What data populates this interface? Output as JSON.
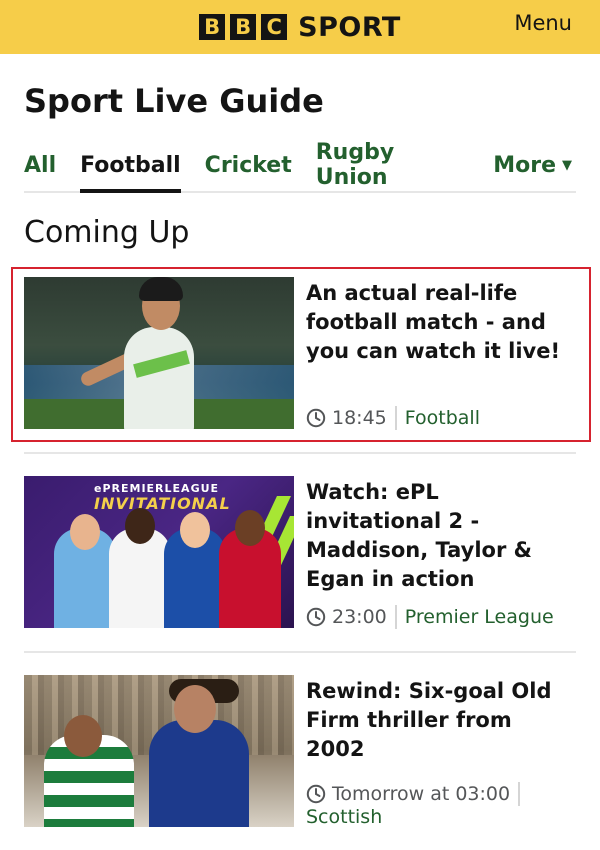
{
  "header": {
    "logo_letters": [
      "B",
      "B",
      "C"
    ],
    "logo_word": "SPORT",
    "menu_label": "Menu",
    "brand_color": "#f6cd49"
  },
  "page": {
    "title": "Sport Live Guide"
  },
  "tabs": [
    {
      "label": "All",
      "active": false
    },
    {
      "label": "Football",
      "active": true
    },
    {
      "label": "Cricket",
      "active": false
    },
    {
      "label": "Rugby Union",
      "active": false
    },
    {
      "label": "More",
      "active": false,
      "icon": "caret-down-icon"
    }
  ],
  "section": {
    "title": "Coming Up"
  },
  "items": [
    {
      "title": "An actual real-life football match - and you can watch it live!",
      "time": "18:45",
      "tag": "Football",
      "highlighted": true,
      "time_icon": "clock-icon"
    },
    {
      "title": "Watch: ePL invitational 2 - Maddison, Taylor & Egan in action",
      "time": "23:00",
      "tag": "Premier League",
      "highlighted": false,
      "time_icon": "clock-icon",
      "thumb_text_top": "ePREMIERLEAGUE",
      "thumb_text_bottom": "INVITATIONAL"
    },
    {
      "title": "Rewind: Six-goal Old Firm thriller from 2002",
      "time": "Tomorrow at 03:00",
      "tag": "Scottish",
      "highlighted": false,
      "time_icon": "clock-icon"
    }
  ],
  "colors": {
    "accent_green": "#23602e",
    "highlight_border": "#d6232f"
  }
}
